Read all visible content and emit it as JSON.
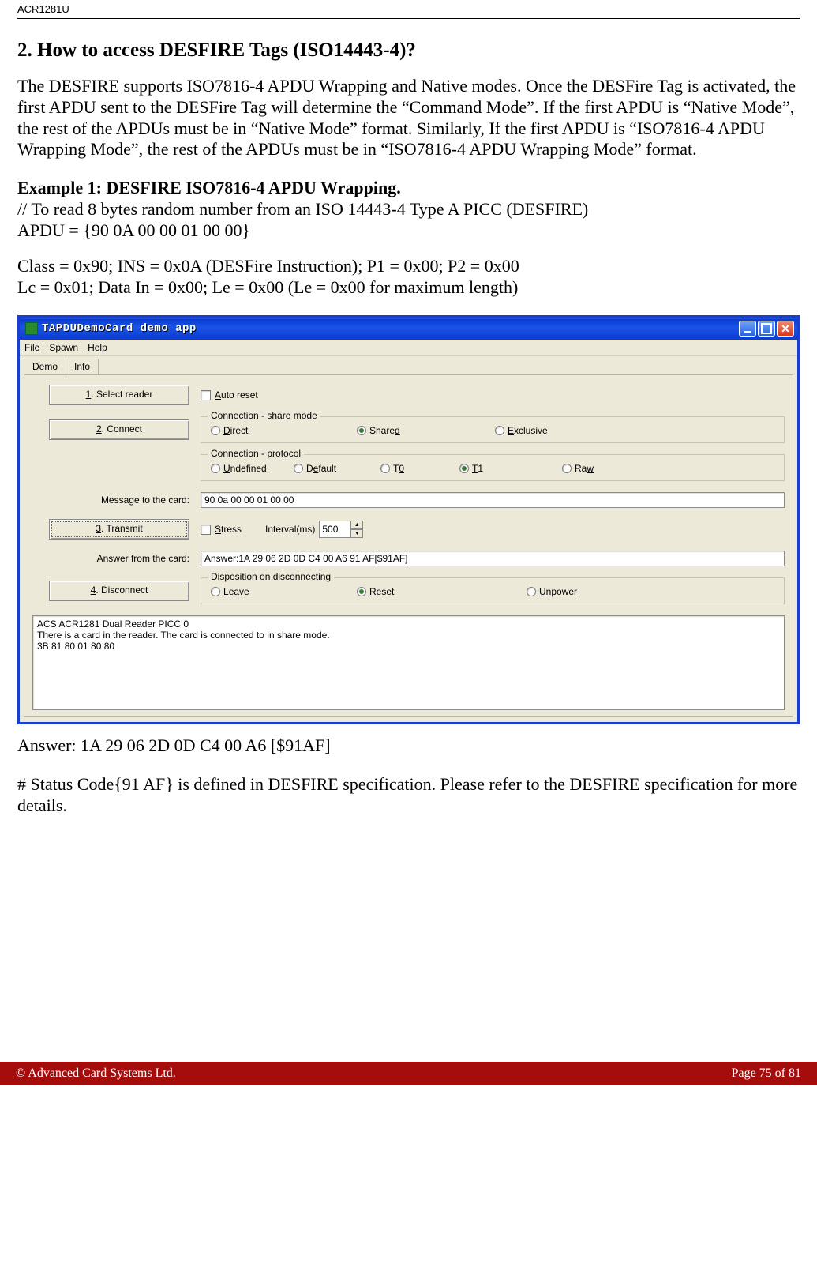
{
  "doc": {
    "header_code": "ACR1281U",
    "section_title": "2. How to access DESFIRE Tags (ISO14443-4)?",
    "intro_para": "The DESFIRE supports ISO7816-4 APDU Wrapping and Native modes. Once the DESFire Tag is activated, the first APDU sent to the DESFire Tag will determine the “Command Mode”. If the first APDU is “Native Mode”, the rest of the APDUs must be in “Native Mode” format. Similarly, If the first APDU is “ISO7816-4 APDU Wrapping Mode”, the rest of the APDUs must be in “ISO7816-4 APDU Wrapping Mode” format.",
    "example_title": "Example 1: DESFIRE ISO7816-4 APDU Wrapping.",
    "example_comment": "// To read 8 bytes random number from an ISO 14443-4 Type A PICC (DESFIRE)",
    "example_apdu": "APDU = {90 0A 00 00 01 00 00}",
    "class_line": "Class = 0x90; INS = 0x0A (DESFire Instruction);  P1 = 0x00;  P2 = 0x00",
    "lc_line": "Lc = 0x01; Data In = 0x00; Le = 0x00 (Le = 0x00 for maximum length)",
    "answer_line": "Answer:  1A 29 06 2D 0D C4 00 A6 [$91AF]",
    "status_note": "# Status Code{91 AF} is defined in DESFIRE specification. Please refer to the DESFIRE specification for more details.",
    "footer_left": "© Advanced Card Systems Ltd.",
    "footer_right": "Page 75 of 81"
  },
  "app": {
    "title": "TAPDUDemoCard demo app",
    "menu": {
      "file": "File",
      "file_u": "F",
      "spawn": "Spawn",
      "spawn_u": "S",
      "help": "Help",
      "help_u": "H"
    },
    "tabs": {
      "demo": "Demo",
      "info": "Info"
    },
    "buttons": {
      "select_reader": "1. Select reader",
      "connect": "2. Connect",
      "transmit": "3. Transmit",
      "disconnect": "4. Disconnect"
    },
    "checkboxes": {
      "auto_reset": "Auto reset",
      "auto_reset_u": "A",
      "stress": "Stress",
      "stress_u": "S"
    },
    "share_mode": {
      "legend": "Connection - share mode",
      "direct": "Direct",
      "direct_u": "D",
      "shared": "Shared",
      "shared_u": "d",
      "exclusive": "Exclusive",
      "exclusive_u": "E",
      "selected": "shared"
    },
    "protocol": {
      "legend": "Connection - protocol",
      "undefined": "Undefined",
      "undefined_u": "U",
      "default": "Default",
      "default_u": "e",
      "t0": "T0",
      "t0_u": "0",
      "t1": "T1",
      "t1_u": "1",
      "raw": "Raw",
      "raw_u": "w",
      "selected": "t1"
    },
    "msg_label": "Message to the card:",
    "msg_value": "90 0a 00 00 01 00 00",
    "interval_label": "Interval(ms)",
    "interval_value": "500",
    "answer_label": "Answer from the card:",
    "answer_value": "Answer:1A 29 06 2D 0D C4 00 A6 91 AF[$91AF]",
    "dispo": {
      "legend": "Disposition on disconnecting",
      "leave": "Leave",
      "leave_u": "L",
      "reset": "Reset",
      "reset_u": "R",
      "unpower": "Unpower",
      "unpower_u": "U",
      "selected": "reset"
    },
    "log": "ACS ACR1281 Dual Reader PICC 0\nThere is a card in the reader. The card is connected to in share mode.\n3B 81 80 01 80 80"
  }
}
